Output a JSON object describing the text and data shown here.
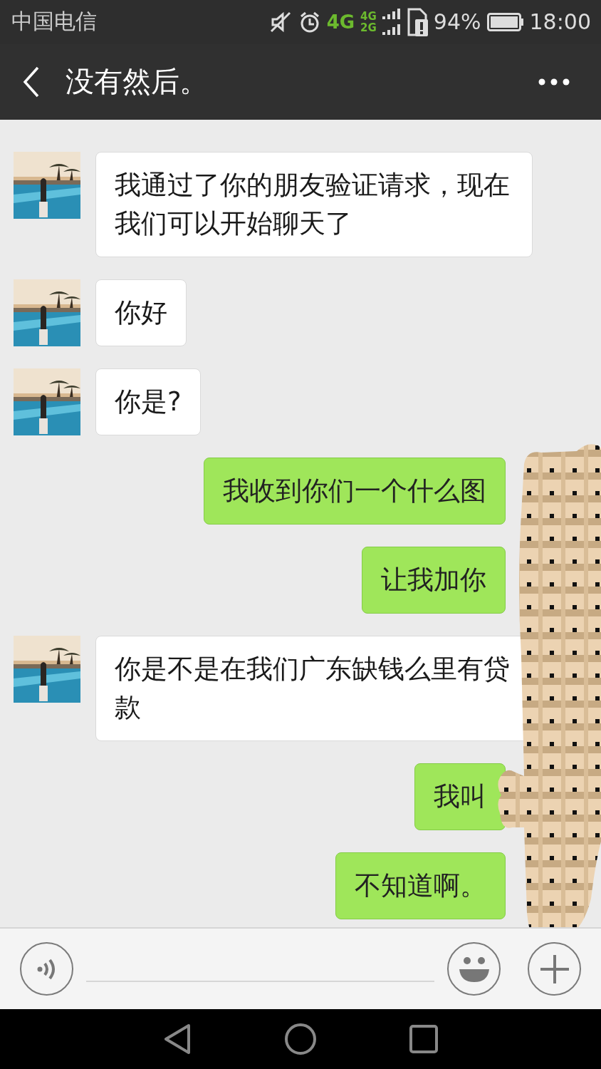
{
  "status_bar": {
    "carrier": "中国电信",
    "network": "4G",
    "sim_networks": [
      "4G",
      "2G"
    ],
    "battery": "94%",
    "time": "18:00"
  },
  "header": {
    "title": "没有然后。"
  },
  "messages": [
    {
      "kind": "received",
      "text": "我通过了你的朋友验证请求，现在我们可以开始聊天了"
    },
    {
      "kind": "received",
      "text": "你好"
    },
    {
      "kind": "received",
      "text": "你是?"
    },
    {
      "kind": "sent",
      "text": "我收到你们一个什么图"
    },
    {
      "kind": "sent",
      "text": "让我加你"
    },
    {
      "kind": "received",
      "text": "你是不是在我们广东缺钱么里有贷款"
    },
    {
      "kind": "sent",
      "text": "我叫"
    },
    {
      "kind": "sent",
      "text": "不知道啊。"
    }
  ]
}
